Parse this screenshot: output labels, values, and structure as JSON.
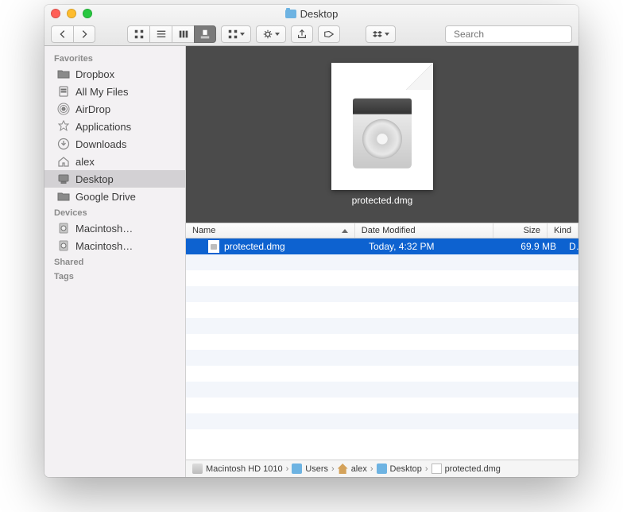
{
  "title": "Desktop",
  "search_placeholder": "Search",
  "sidebar": {
    "sections": [
      {
        "header": "Favorites",
        "items": [
          {
            "icon": "folder",
            "label": "Dropbox"
          },
          {
            "icon": "allfiles",
            "label": "All My Files"
          },
          {
            "icon": "airdrop",
            "label": "AirDrop"
          },
          {
            "icon": "apps",
            "label": "Applications"
          },
          {
            "icon": "downloads",
            "label": "Downloads"
          },
          {
            "icon": "home",
            "label": "alex"
          },
          {
            "icon": "desktop",
            "label": "Desktop",
            "selected": true
          },
          {
            "icon": "folder",
            "label": "Google Drive"
          }
        ]
      },
      {
        "header": "Devices",
        "items": [
          {
            "icon": "disk",
            "label": "Macintosh…"
          },
          {
            "icon": "disk",
            "label": "Macintosh…"
          }
        ]
      },
      {
        "header": "Shared",
        "items": []
      },
      {
        "header": "Tags",
        "items": []
      }
    ]
  },
  "columns": {
    "name": "Name",
    "date": "Date Modified",
    "size": "Size",
    "kind": "Kind"
  },
  "coverflow_label": "protected.dmg",
  "files": [
    {
      "name": "protected.dmg",
      "date": "Today, 4:32 PM",
      "size": "69.9 MB",
      "kind": "Disk Image",
      "selected": true
    }
  ],
  "blank_rows": 12,
  "pathbar": [
    {
      "icon": "disk",
      "label": "Macintosh HD 1010"
    },
    {
      "icon": "folder",
      "label": "Users"
    },
    {
      "icon": "home",
      "label": "alex"
    },
    {
      "icon": "folder",
      "label": "Desktop"
    },
    {
      "icon": "doc",
      "label": "protected.dmg"
    }
  ]
}
